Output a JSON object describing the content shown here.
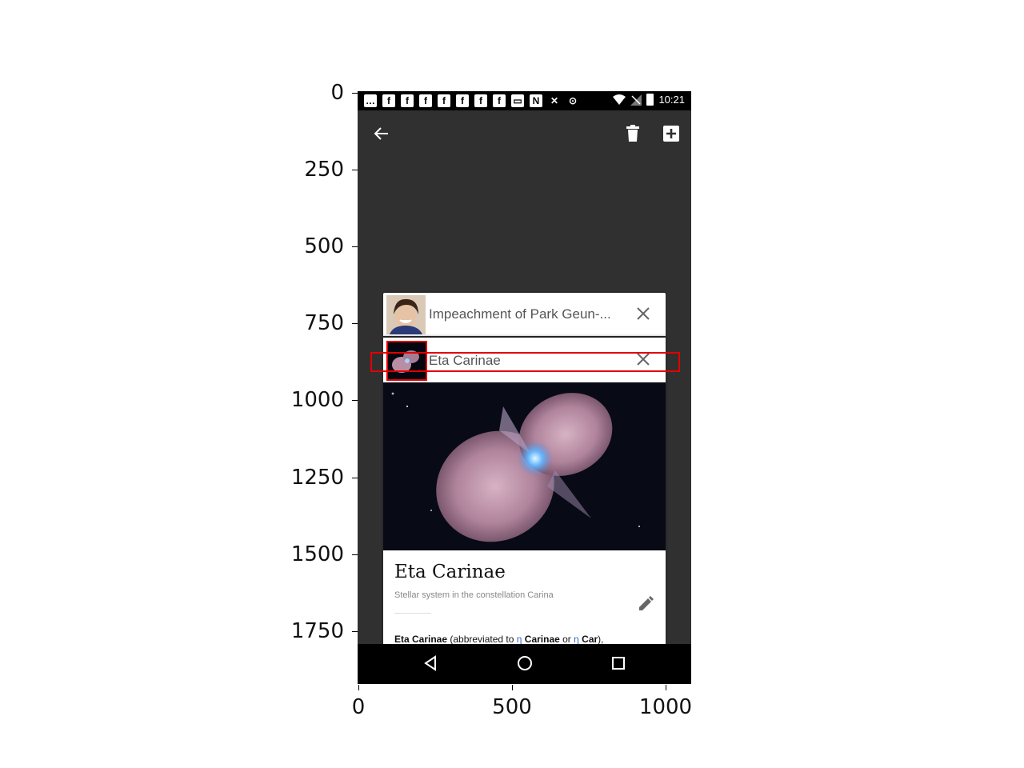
{
  "axes": {
    "y_ticks": [
      "0",
      "250",
      "500",
      "750",
      "1000",
      "1250",
      "1500",
      "1750"
    ],
    "x_ticks": [
      "0",
      "500",
      "1000"
    ]
  },
  "status_bar": {
    "time": "10:21",
    "notification_icons": [
      "message-icon",
      "facebook-icon",
      "facebook-icon",
      "facebook-icon",
      "facebook-icon",
      "facebook-icon",
      "facebook-icon",
      "facebook-icon",
      "gallery-icon",
      "n-icon",
      "settings-off-icon",
      "sync-icon"
    ]
  },
  "toolbar": {
    "back_icon": "arrow-left-icon",
    "delete_icon": "trash-icon",
    "add_icon": "add-box-icon"
  },
  "tabs": [
    {
      "title": "Impeachment of Park Geun-...",
      "close_icon": "close-icon"
    },
    {
      "title": "Eta Carinae",
      "close_icon": "close-icon"
    }
  ],
  "article": {
    "title": "Eta Carinae",
    "description": "Stellar system in the constellation Carina",
    "body_bold_1": "Eta Carinae",
    "body_text_1": " (abbreviated to ",
    "body_link_1": "η",
    "body_bold_2": " Carinae",
    "body_text_2": " or ",
    "body_link_2": "η",
    "body_bold_3": " Car",
    "body_text_3": "),"
  },
  "colors": {
    "background": "#303030",
    "annotation": "#e00000",
    "link": "#3366cc"
  }
}
